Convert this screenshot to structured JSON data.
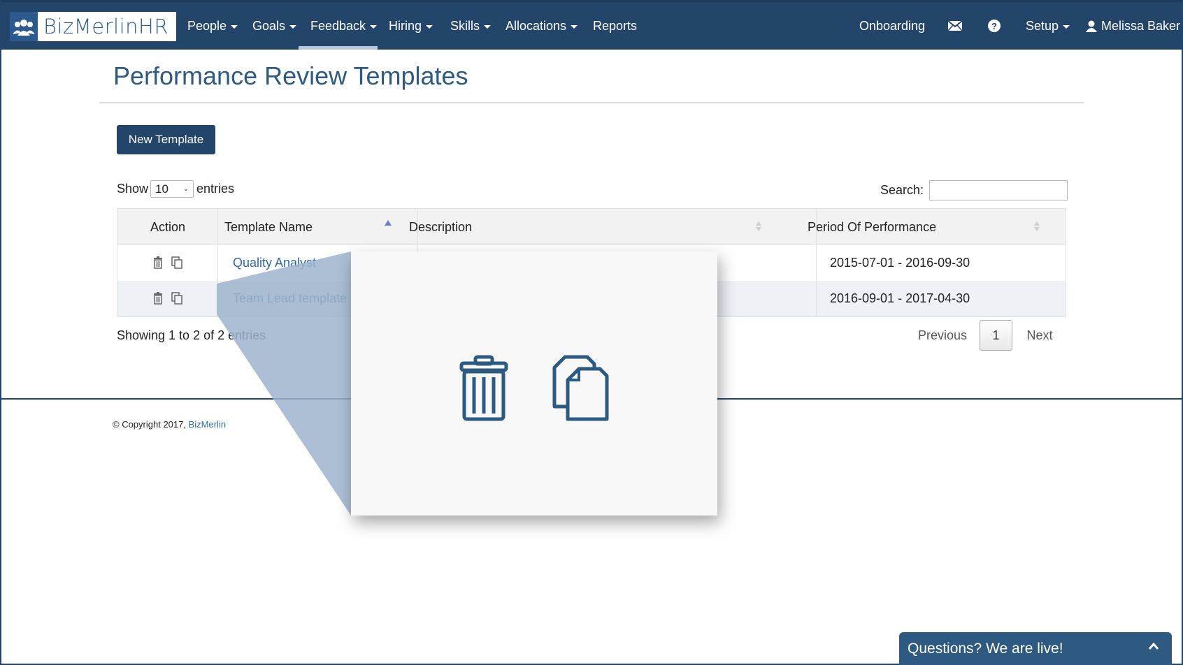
{
  "brand": {
    "name": "BizMerlinHR"
  },
  "nav": {
    "items": [
      {
        "label": "People",
        "has_caret": true
      },
      {
        "label": "Goals",
        "has_caret": true
      },
      {
        "label": "Feedback",
        "has_caret": true,
        "active": true
      },
      {
        "label": "Hiring",
        "has_caret": true
      },
      {
        "label": "Skills",
        "has_caret": true
      },
      {
        "label": "Allocations",
        "has_caret": true
      },
      {
        "label": "Reports",
        "has_caret": false
      }
    ],
    "right": {
      "onboarding": "Onboarding",
      "mail_icon": "envelope-icon",
      "help_icon": "question-circle-icon",
      "setup": "Setup",
      "user": "Melissa Baker"
    }
  },
  "page": {
    "title": "Performance Review Templates",
    "new_button": "New Template",
    "show_label": "Show",
    "page_size": "10",
    "entries_label": "entries",
    "search_label": "Search:"
  },
  "table": {
    "columns": [
      "Action",
      "Template Name",
      "Description",
      "Period Of Performance"
    ],
    "rows": [
      {
        "name": "Quality Analyst",
        "description": "",
        "period": "2015-07-01 - 2016-09-30"
      },
      {
        "name": "Team Lead template",
        "description": "",
        "period": "2016-09-01 - 2017-04-30"
      }
    ]
  },
  "pagination": {
    "info": "Showing 1 to 2 of 2 entries",
    "previous": "Previous",
    "current": "1",
    "next": "Next"
  },
  "footer": {
    "copyright": "© Copyright 2017,",
    "link": "BizMerlin"
  },
  "chat": {
    "label": "Questions? We are live!"
  },
  "colors": {
    "navbar": "#24456a",
    "accent": "#2e6aa8",
    "title": "#2f5a80"
  }
}
